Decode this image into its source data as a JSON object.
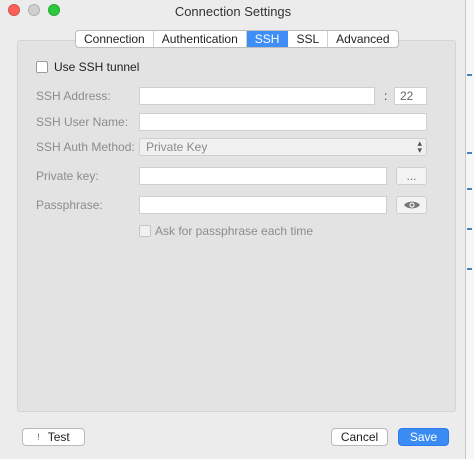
{
  "window": {
    "title": "Connection Settings"
  },
  "tabs": [
    {
      "label": "Connection",
      "active": false
    },
    {
      "label": "Authentication",
      "active": false
    },
    {
      "label": "SSH",
      "active": true
    },
    {
      "label": "SSL",
      "active": false
    },
    {
      "label": "Advanced",
      "active": false
    }
  ],
  "ssh": {
    "use_tunnel_label": "Use SSH tunnel",
    "address_label": "SSH Address:",
    "address_value": "",
    "port_separator": ":",
    "port_value": "22",
    "user_label": "SSH User Name:",
    "user_value": "",
    "auth_method_label": "SSH Auth Method:",
    "auth_method_value": "Private Key",
    "private_key_label": "Private key:",
    "private_key_value": "",
    "browse_label": "...",
    "passphrase_label": "Passphrase:",
    "passphrase_value": "",
    "ask_passphrase_label": "Ask for passphrase each time"
  },
  "footer": {
    "test_label": "Test",
    "test_icon": "!",
    "cancel_label": "Cancel",
    "save_label": "Save"
  },
  "colors": {
    "accent": "#3f8ef7",
    "close": "#fc5f57",
    "zoom": "#2bc840"
  }
}
